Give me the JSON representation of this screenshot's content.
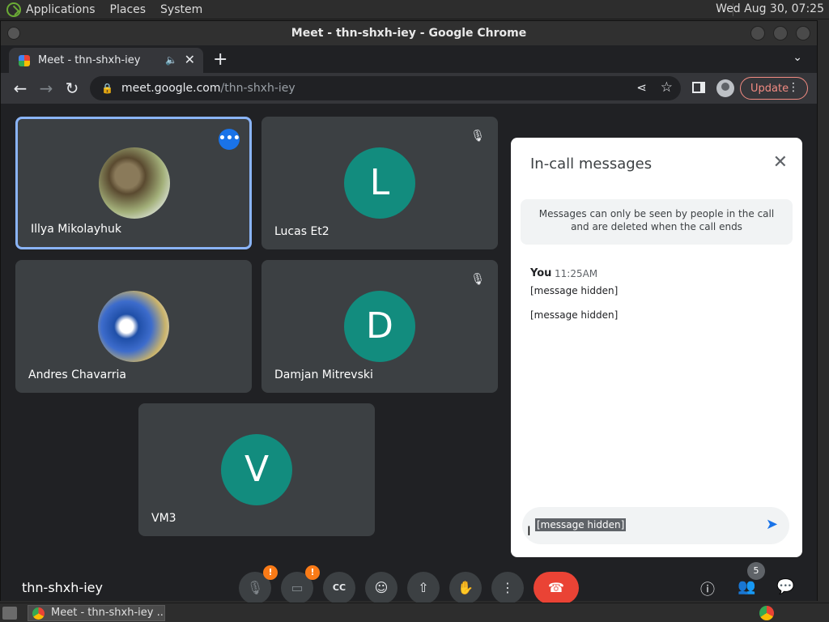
{
  "top_panel": {
    "menus": [
      "Applications",
      "Places",
      "System"
    ],
    "clock": "Wed Aug 30, 07:25"
  },
  "window": {
    "title": "Meet - thn-shxh-iey - Google Chrome"
  },
  "browser": {
    "tab_title": "Meet - thn-shxh-iey",
    "url_host": "meet.google.com",
    "url_path": "/thn-shxh-iey",
    "update_label": "Update"
  },
  "meet": {
    "participants": [
      {
        "name": "Illya Mikolayhuk",
        "photo": "dog-photo",
        "active": true
      },
      {
        "name": "Lucas Et2",
        "initial": "L",
        "muted": true
      },
      {
        "name": "Andres Chavarria",
        "photo": "fans-photo"
      },
      {
        "name": "Damjan Mitrevski",
        "initial": "D",
        "muted": true
      },
      {
        "name": "VM3",
        "initial": "V"
      }
    ],
    "meeting_code": "thn-shxh-iey",
    "participant_count": "5",
    "colors": {
      "avatar": "#128c7e",
      "active_border": "#8ab4f8",
      "end_call": "#ea4335",
      "warning": "#fa7b17"
    }
  },
  "chat": {
    "title": "In-call messages",
    "notice": "Messages can only be seen by people in the call and are deleted when the call ends",
    "sender": "You",
    "time": "11:25AM",
    "messages": [
      "[message hidden]",
      "[message hidden]"
    ],
    "input_value": "[message hidden]"
  },
  "taskbar": {
    "task_label": "Meet - thn-shxh-iey ..."
  }
}
